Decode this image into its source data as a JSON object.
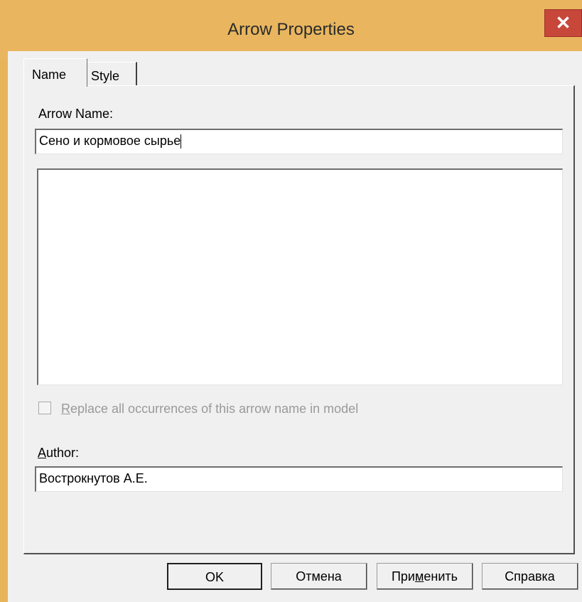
{
  "window": {
    "title": "Arrow Properties",
    "close_glyph": "✕",
    "accent_color": "#e9b65f",
    "close_color": "#c7473b"
  },
  "tabs": [
    {
      "label": "Name",
      "active": true
    },
    {
      "label": "Style",
      "active": false
    }
  ],
  "name_tab": {
    "arrow_name_label": "Arrow Name:",
    "arrow_name_value": "Сено и кормовое сырье",
    "description_value": "",
    "replace_checkbox": {
      "label_first": "R",
      "label_rest": "eplace all occurrences of this arrow name in model",
      "checked": false,
      "enabled": false
    },
    "author_label_first": "A",
    "author_label_rest": "uthor:",
    "author_value": "Вострокнутов А.Е."
  },
  "buttons": {
    "ok": "OK",
    "cancel": "Отмена",
    "apply_pre": "При",
    "apply_mnemonic": "м",
    "apply_post": "енить",
    "help": "Справка"
  }
}
